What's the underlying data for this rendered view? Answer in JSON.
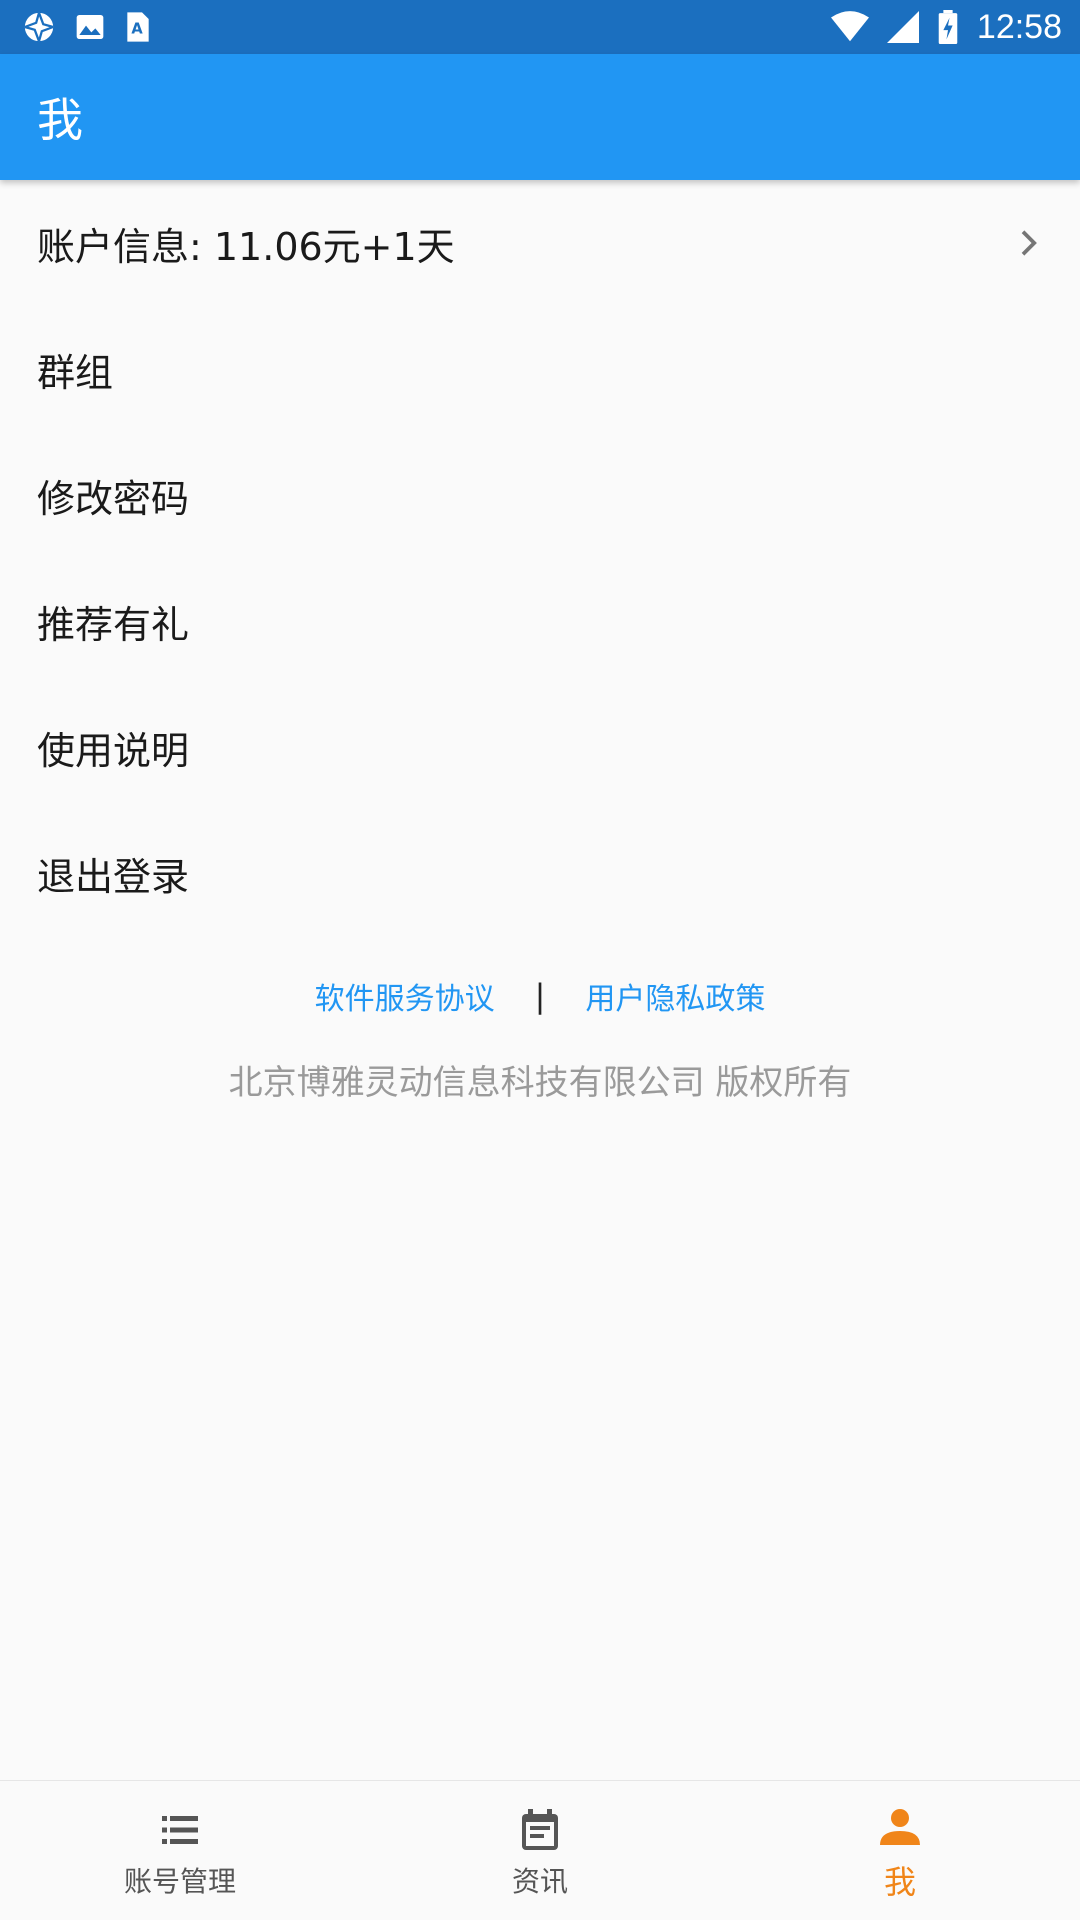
{
  "status_bar": {
    "time": "12:58",
    "left_icons": [
      "aperture-icon",
      "image-icon",
      "text-app-icon"
    ],
    "right_icons": [
      "wifi-icon",
      "signal-icon",
      "battery-charging-icon"
    ]
  },
  "app_bar": {
    "title": "我"
  },
  "menu": {
    "items": [
      {
        "label": "账户信息: 11.06元+1天",
        "has_chevron": true
      },
      {
        "label": "群组"
      },
      {
        "label": "修改密码"
      },
      {
        "label": "推荐有礼"
      },
      {
        "label": "使用说明"
      },
      {
        "label": "退出登录"
      }
    ]
  },
  "footer": {
    "service_agreement": "软件服务协议",
    "separator": "|",
    "privacy_policy": "用户隐私政策",
    "copyright": "北京博雅灵动信息科技有限公司 版权所有"
  },
  "bottom_nav": {
    "items": [
      {
        "label": "账号管理",
        "icon": "list-icon"
      },
      {
        "label": "资讯",
        "icon": "calendar-note-icon"
      },
      {
        "label": "我",
        "icon": "person-icon",
        "active": true
      }
    ]
  },
  "colors": {
    "status_bar": "#1b6fbf",
    "primary": "#2196f3",
    "active_tab": "#f08519",
    "link": "#2196f3"
  }
}
